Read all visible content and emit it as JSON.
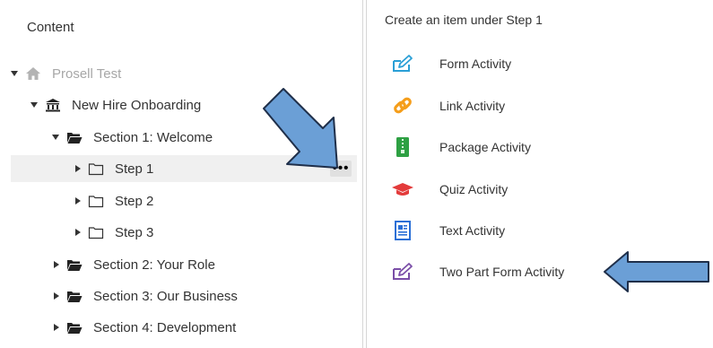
{
  "left": {
    "title": "Content",
    "tree": [
      {
        "label": "Prosell Test",
        "icon": "home-icon"
      },
      {
        "label": "New Hire Onboarding",
        "icon": "building-icon"
      },
      {
        "label": "Section 1: Welcome",
        "icon": "open-folder-icon"
      },
      {
        "label": "Step 1",
        "icon": "folder-icon",
        "selected": true
      },
      {
        "label": "Step 2",
        "icon": "folder-icon"
      },
      {
        "label": "Step 3",
        "icon": "folder-icon"
      },
      {
        "label": "Section 2: Your Role",
        "icon": "open-folder-icon"
      },
      {
        "label": "Section 3: Our Business",
        "icon": "open-folder-icon"
      },
      {
        "label": "Section 4: Development",
        "icon": "open-folder-icon"
      }
    ],
    "more_menu": "•••"
  },
  "right": {
    "title": "Create an item under Step 1",
    "activities": [
      {
        "label": "Form Activity",
        "icon": "form-edit-icon"
      },
      {
        "label": "Link Activity",
        "icon": "link-icon"
      },
      {
        "label": "Package Activity",
        "icon": "package-zip-icon"
      },
      {
        "label": "Quiz Activity",
        "icon": "graduation-cap-icon"
      },
      {
        "label": "Text Activity",
        "icon": "text-document-icon"
      },
      {
        "label": "Two Part Form Activity",
        "icon": "two-part-form-icon"
      }
    ]
  },
  "colors": {
    "accent_blue": "#3d8fd6",
    "arrow_fill": "#6b9fd6",
    "link_orange": "#f59e1b",
    "package_green": "#2ea043",
    "quiz_red": "#e33b3b",
    "form_purple": "#7b4fa8",
    "selected_bg": "#f0f0f0"
  }
}
